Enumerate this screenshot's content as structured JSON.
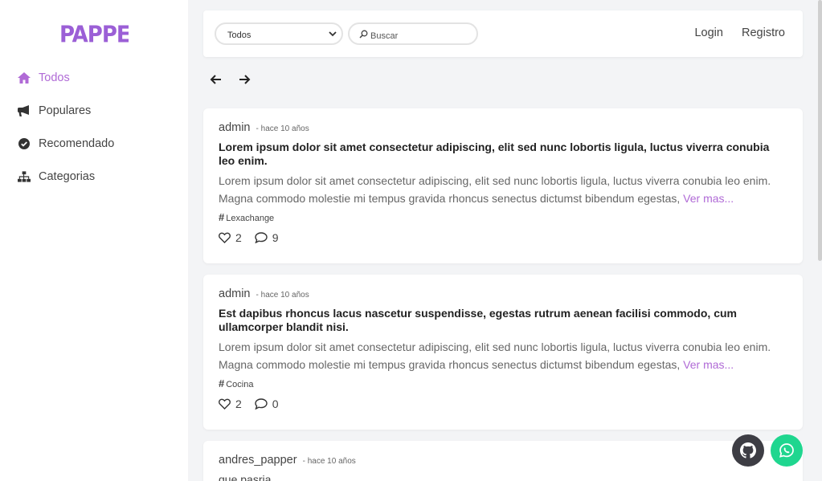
{
  "brand": {
    "logo_text": "PAPPER",
    "accent": "#b06ad6"
  },
  "sidebar": {
    "items": [
      {
        "label": "Todos",
        "icon": "home-icon",
        "active": true
      },
      {
        "label": "Populares",
        "icon": "megaphone-icon",
        "active": false
      },
      {
        "label": "Recomendado",
        "icon": "check-circle-icon",
        "active": false
      },
      {
        "label": "Categorias",
        "icon": "sitemap-icon",
        "active": false
      }
    ]
  },
  "topbar": {
    "filter_selected": "Todos",
    "search_placeholder": "Buscar",
    "login_label": "Login",
    "register_label": "Registro"
  },
  "posts": [
    {
      "author": "admin",
      "time": "- hace 10 años",
      "title": "Lorem ipsum dolor sit amet consectetur adipiscing, elit sed nunc lobortis ligula, luctus viverra conubia leo enim.",
      "body": "Lorem ipsum dolor sit amet consectetur adipiscing, elit sed nunc lobortis ligula, luctus viverra conubia leo enim. Magna commodo molestie mi tempus gravida rhoncus senectus dictumst bibendum egestas,",
      "more": "Ver mas...",
      "tag": "Lexachange",
      "likes": "2",
      "comments": "9"
    },
    {
      "author": "admin",
      "time": "- hace 10 años",
      "title": "Est dapibus rhoncus lacus nascetur suspendisse, egestas rutrum aenean facilisi commodo, cum ullamcorper blandit nisi.",
      "body": "Lorem ipsum dolor sit amet consectetur adipiscing, elit sed nunc lobortis ligula, luctus viverra conubia leo enim. Magna commodo molestie mi tempus gravida rhoncus senectus dictumst bibendum egestas,",
      "more": "Ver mas...",
      "tag": "Cocina",
      "likes": "2",
      "comments": "0"
    },
    {
      "author": "andres_papper",
      "time": "- hace 10 años",
      "title": "que pasria"
    }
  ]
}
